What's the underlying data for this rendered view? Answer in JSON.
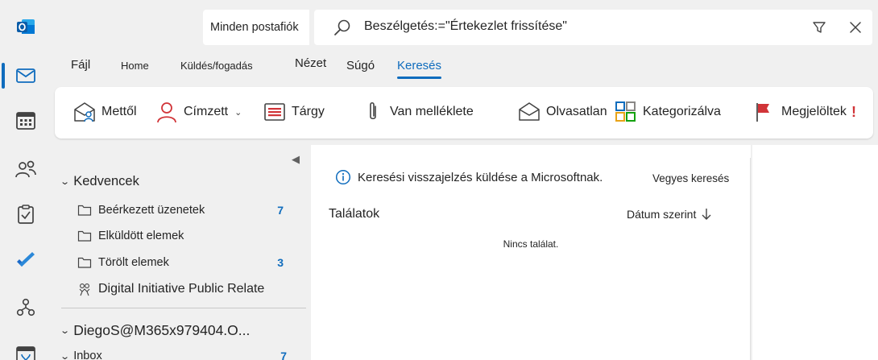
{
  "rail": {
    "items": [
      {
        "icon": "outlook-logo-icon"
      },
      {
        "icon": "mail-icon",
        "active": true
      },
      {
        "icon": "calendar-icon"
      },
      {
        "icon": "people-icon"
      },
      {
        "icon": "tasks-icon"
      },
      {
        "icon": "todo-icon"
      },
      {
        "icon": "org-explorer-icon"
      },
      {
        "icon": "bookings-icon"
      }
    ]
  },
  "search": {
    "scope": "Minden postafiók",
    "query": "Beszélgetés:=\"Értekezlet frissítése\""
  },
  "tabs": {
    "file": "Fájl",
    "home": "Home",
    "send_receive": "Küldés/fogadás",
    "view": "Nézet",
    "help": "Súgó",
    "search": "Keresés"
  },
  "ribbon": {
    "from": "Mettől",
    "to": "Címzett",
    "subject": "Tárgy",
    "attachments": "Van melléklete",
    "unread": "Olvasatlan",
    "categorized": "Kategorizálva",
    "flagged": "Megjelöltek",
    "important_mark": "!"
  },
  "colors": {
    "accent": "#0f6cbd",
    "flag": "#d13438"
  },
  "folders": {
    "favorites_label": "Kedvencek",
    "items": [
      {
        "label": "Beérkezett üzenetek",
        "count": "7"
      },
      {
        "label": "Elküldött elemek",
        "count": ""
      },
      {
        "label": "Törölt elemek",
        "count": "3"
      },
      {
        "label": "Digital Initiative Public Relate",
        "count": ""
      }
    ],
    "account_label": "DiegoS@M365x979404.O...",
    "inbox_label": "Inbox",
    "inbox_count": "7"
  },
  "results": {
    "feedback": "Keresési visszajelzés küldése a Microsoftnak.",
    "mixed_search": "Vegyes keresés",
    "title": "Találatok",
    "sort": "Dátum szerint",
    "no_results": "Nincs találat."
  }
}
